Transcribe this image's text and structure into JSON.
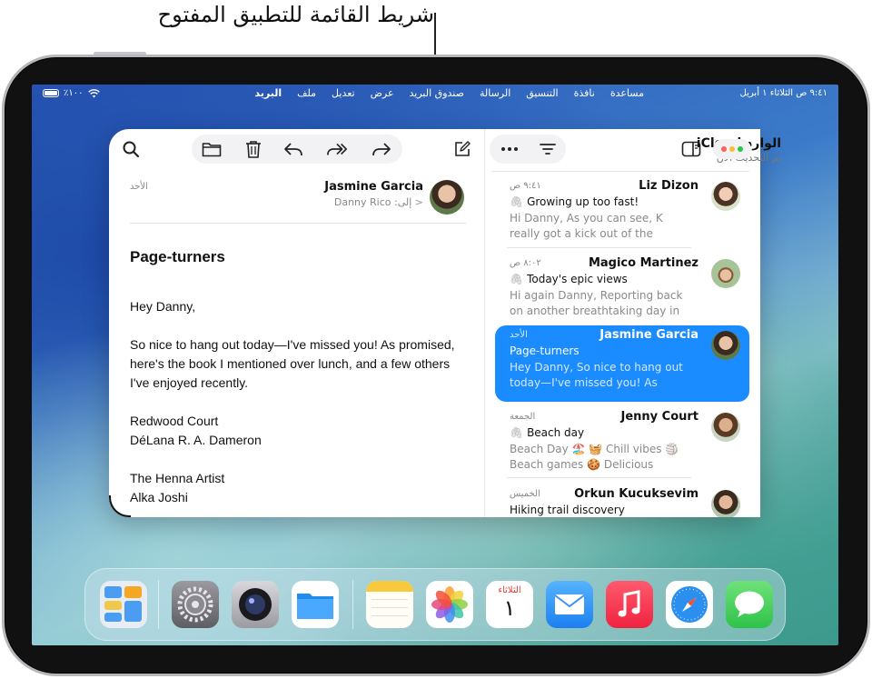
{
  "callout": {
    "label": "شريط القائمة للتطبيق المفتوح"
  },
  "status_bar": {
    "time": "٩:٤١ ص الثلاثاء ١ أبريل",
    "battery": "٪١٠٠"
  },
  "menubar": {
    "items": [
      "البريد",
      "ملف",
      "تعديل",
      "عرض",
      "صندوق البريد",
      "الرسالة",
      "التنسيق",
      "نافذة",
      "مساعدة"
    ]
  },
  "mailbox": {
    "title": "الوارد iCloud",
    "subtitle": "تم التحديث الآن"
  },
  "mail_list": [
    {
      "name": "Liz Dizon",
      "date": "٩:٤١ ص",
      "subject": "Growing up too fast!",
      "preview": "Hi Danny, As you can see, K really got a kick out of the bubbles! Ca…",
      "attachment": true,
      "avatar_color": "#c9a58a"
    },
    {
      "name": "Magico Martinez",
      "date": "٨:٠٢ ص",
      "subject": "Today's epic views",
      "preview": "Hi again Danny, Reporting back on another breathtaking day in the…",
      "attachment": true,
      "avatar_color": "#9bc08a"
    },
    {
      "name": "Jasmine Garcia",
      "date": "الأحد",
      "subject": "Page-turners",
      "preview": "Hey Danny, So nice to hang out today—I've missed you! As promi…",
      "attachment": false,
      "avatar_color": "#6d8a5c",
      "selected": true
    },
    {
      "name": "Jenny Court",
      "date": "الجمعة",
      "subject": "Beach day",
      "preview": "Beach Day 🏖️ 🧺 Chill vibes 🏐 Beach games 🍪 Delicious snack…",
      "attachment": true,
      "avatar_color": "#b8876a"
    },
    {
      "name": "Orkun Kucuksevim",
      "date": "الخميس",
      "subject": "Hiking trail discovery",
      "preview": "",
      "attachment": false,
      "avatar_color": "#a0785a"
    }
  ],
  "message": {
    "from": "Jasmine Garcia",
    "to": "إلى: Danny Rico",
    "date": "الأحد",
    "subject": "Page-turners",
    "greeting": "Hey Danny,",
    "paragraph": "So nice to hang out today—I've missed you! As promised, here's the book I mentioned over lunch, and a few others I've enjoyed recently.",
    "book1_title": "Redwood Court",
    "book1_author": "DéLana R. A. Dameron",
    "book2_title": "The Henna Artist",
    "book2_author": "Alka Joshi"
  },
  "dock": {
    "calendar_day_name": "الثلاثاء",
    "calendar_day_num": "١"
  },
  "colors": {
    "accent": "#1a8cff",
    "selected_row": "#1a8cff"
  }
}
